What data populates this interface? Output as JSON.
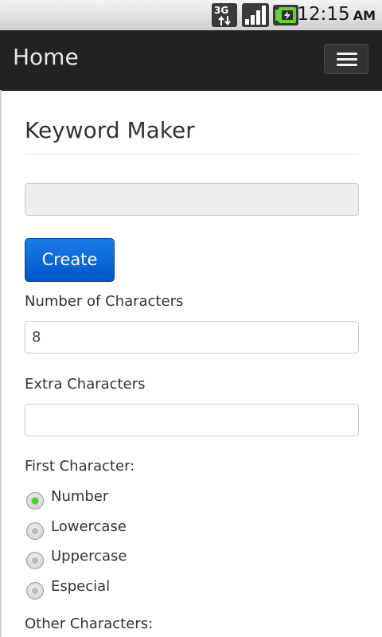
{
  "statusbar": {
    "network": "3G",
    "time": "12:15",
    "ampm": "AM",
    "icons": [
      "3g-data-icon",
      "signal-strength-icon",
      "battery-charging-icon"
    ]
  },
  "navbar": {
    "title": "Home",
    "menu_icon": "hamburger-menu-icon",
    "background": "#222222"
  },
  "main": {
    "title": "Keyword Maker",
    "keyword_output_value": "",
    "create_label": "Create",
    "num_chars_label": "Number of Characters",
    "num_chars_value": "8",
    "extra_chars_label": "Extra Characters",
    "extra_chars_value": "",
    "first_char_label": "First Character:",
    "first_char_options": [
      {
        "label": "Number",
        "checked": true
      },
      {
        "label": "Lowercase",
        "checked": false
      },
      {
        "label": "Uppercase",
        "checked": false
      },
      {
        "label": "Especial",
        "checked": false
      }
    ],
    "other_chars_label": "Other Characters:"
  },
  "colors": {
    "accent_button": "#0066dd",
    "radio_selected": "#46d21e"
  }
}
